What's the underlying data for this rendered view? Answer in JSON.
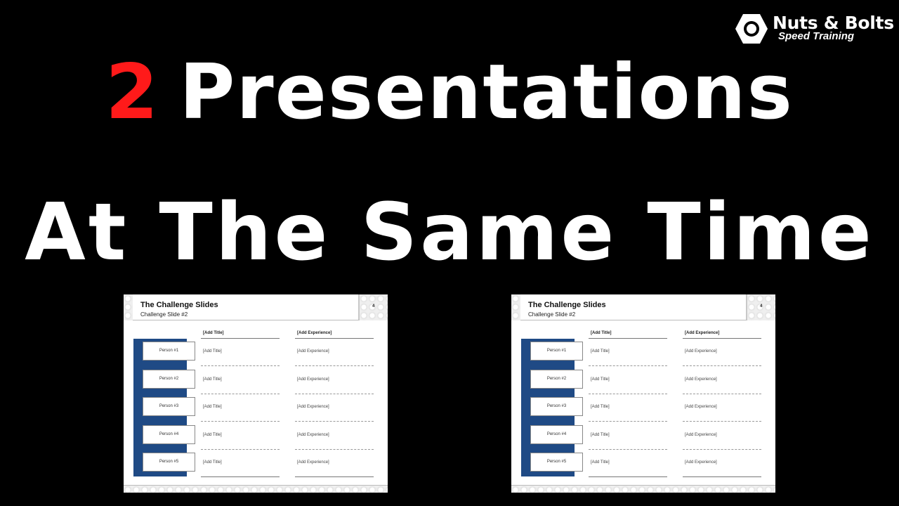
{
  "logo": {
    "icon": "hex-nut-icon",
    "name": "Nuts & Bolts",
    "subtitle": "Speed Training"
  },
  "headline": {
    "number": "2",
    "line1_rest": "Presentations",
    "line2": "At The Same Time",
    "number_color": "#ff1a1a"
  },
  "slides": [
    {
      "title": "The Challenge Slides",
      "subtitle": "Challenge Slide #2",
      "slide_number": "4",
      "columns": [
        "[Add Title]",
        "[Add Experience]"
      ],
      "rows": [
        {
          "person": "Person #1",
          "title": "[Add Title]",
          "experience": "[Add Experience]"
        },
        {
          "person": "Person #2",
          "title": "[Add Title]",
          "experience": "[Add Experience]"
        },
        {
          "person": "Person #3",
          "title": "[Add Title]",
          "experience": "[Add Experience]"
        },
        {
          "person": "Person #4",
          "title": "[Add Title]",
          "experience": "[Add Experience]"
        },
        {
          "person": "Person #5",
          "title": "[Add Title]",
          "experience": "[Add Experience]"
        }
      ],
      "accent_color": "#1f4a85"
    },
    {
      "title": "The Challenge Slides",
      "subtitle": "Challenge Slide #2",
      "slide_number": "4",
      "columns": [
        "[Add Title]",
        "[Add Experience]"
      ],
      "rows": [
        {
          "person": "Person #1",
          "title": "[Add Title]",
          "experience": "[Add Experience]"
        },
        {
          "person": "Person #2",
          "title": "[Add Title]",
          "experience": "[Add Experience]"
        },
        {
          "person": "Person #3",
          "title": "[Add Title]",
          "experience": "[Add Experience]"
        },
        {
          "person": "Person #4",
          "title": "[Add Title]",
          "experience": "[Add Experience]"
        },
        {
          "person": "Person #5",
          "title": "[Add Title]",
          "experience": "[Add Experience]"
        }
      ],
      "accent_color": "#1f4a85"
    }
  ]
}
